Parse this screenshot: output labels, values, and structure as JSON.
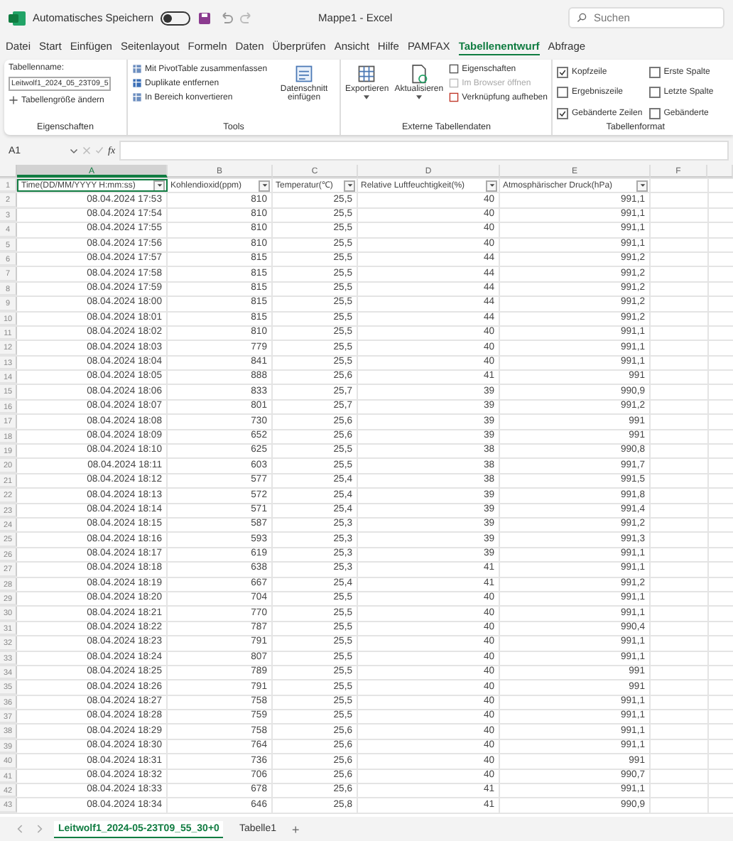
{
  "titlebar": {
    "autosave_label": "Automatisches Speichern",
    "autosave_on": false,
    "title": "Mappe1 - Excel",
    "search_placeholder": "Suchen"
  },
  "menu_tabs": [
    {
      "label": "Datei",
      "selected": false
    },
    {
      "label": "Start",
      "selected": false
    },
    {
      "label": "Einfügen",
      "selected": false
    },
    {
      "label": "Seitenlayout",
      "selected": false
    },
    {
      "label": "Formeln",
      "selected": false
    },
    {
      "label": "Daten",
      "selected": false
    },
    {
      "label": "Überprüfen",
      "selected": false
    },
    {
      "label": "Ansicht",
      "selected": false
    },
    {
      "label": "Hilfe",
      "selected": false
    },
    {
      "label": "PAMFAX",
      "selected": false
    },
    {
      "label": "Tabellenentwurf",
      "selected": true
    },
    {
      "label": "Abfrage",
      "selected": false
    }
  ],
  "ribbon": {
    "eigenschaften": {
      "name_label": "Tabellenname:",
      "name_value": "Leitwolf1_2024_05_23T09_5",
      "resize": "Tabellengröße ändern",
      "group": "Eigenschaften"
    },
    "tools": {
      "items": [
        "Mit PivotTable zusammenfassen",
        "Duplikate entfernen",
        "In Bereich konvertieren"
      ],
      "slicer": "Datenschnitt einfügen",
      "group": "Tools"
    },
    "extern": {
      "export": "Exportieren",
      "refresh": "Aktualisieren",
      "items": [
        {
          "label": "Eigenschaften",
          "disabled": false
        },
        {
          "label": "Im Browser öffnen",
          "disabled": true
        },
        {
          "label": "Verknüpfung aufheben",
          "disabled": false
        }
      ],
      "group": "Externe Tabellendaten"
    },
    "format": {
      "options": [
        {
          "label": "Kopfzeile",
          "checked": true
        },
        {
          "label": "Ergebniszeile",
          "checked": false
        },
        {
          "label": "Gebänderte Zeilen",
          "checked": true
        },
        {
          "label": "Erste Spalte",
          "checked": false
        },
        {
          "label": "Letzte Spalte",
          "checked": false
        },
        {
          "label": "Gebänderte",
          "checked": false
        }
      ],
      "group": "Tabellenformat"
    }
  },
  "formula_bar": {
    "name_box": "A1",
    "fx": "fx"
  },
  "sheet": {
    "columns": [
      {
        "letter": "A",
        "selected": true
      },
      {
        "letter": "B",
        "selected": false
      },
      {
        "letter": "C",
        "selected": false
      },
      {
        "letter": "D",
        "selected": false
      },
      {
        "letter": "E",
        "selected": false
      },
      {
        "letter": "F",
        "selected": false
      }
    ],
    "header_row": {
      "number": "1",
      "cells": [
        "Time(DD/MM/YYYY H:mm:ss)",
        "Kohlendioxid(ppm)",
        "Temperatur(℃)",
        "Relative Luftfeuchtigkeit(%)",
        "Atmosphärischer Druck(hPa)"
      ]
    },
    "rows": [
      {
        "number": "2",
        "cells": [
          "08.04.2024 17:53",
          "810",
          "25,5",
          "40",
          "991,1"
        ]
      },
      {
        "number": "3",
        "cells": [
          "08.04.2024 17:54",
          "810",
          "25,5",
          "40",
          "991,1"
        ]
      },
      {
        "number": "4",
        "cells": [
          "08.04.2024 17:55",
          "810",
          "25,5",
          "40",
          "991,1"
        ]
      },
      {
        "number": "5",
        "cells": [
          "08.04.2024 17:56",
          "810",
          "25,5",
          "40",
          "991,1"
        ]
      },
      {
        "number": "6",
        "cells": [
          "08.04.2024 17:57",
          "815",
          "25,5",
          "44",
          "991,2"
        ]
      },
      {
        "number": "7",
        "cells": [
          "08.04.2024 17:58",
          "815",
          "25,5",
          "44",
          "991,2"
        ]
      },
      {
        "number": "8",
        "cells": [
          "08.04.2024 17:59",
          "815",
          "25,5",
          "44",
          "991,2"
        ]
      },
      {
        "number": "9",
        "cells": [
          "08.04.2024 18:00",
          "815",
          "25,5",
          "44",
          "991,2"
        ]
      },
      {
        "number": "10",
        "cells": [
          "08.04.2024 18:01",
          "815",
          "25,5",
          "44",
          "991,2"
        ]
      },
      {
        "number": "11",
        "cells": [
          "08.04.2024 18:02",
          "810",
          "25,5",
          "40",
          "991,1"
        ]
      },
      {
        "number": "12",
        "cells": [
          "08.04.2024 18:03",
          "779",
          "25,5",
          "40",
          "991,1"
        ]
      },
      {
        "number": "13",
        "cells": [
          "08.04.2024 18:04",
          "841",
          "25,5",
          "40",
          "991,1"
        ]
      },
      {
        "number": "14",
        "cells": [
          "08.04.2024 18:05",
          "888",
          "25,6",
          "41",
          "991"
        ]
      },
      {
        "number": "15",
        "cells": [
          "08.04.2024 18:06",
          "833",
          "25,7",
          "39",
          "990,9"
        ]
      },
      {
        "number": "16",
        "cells": [
          "08.04.2024 18:07",
          "801",
          "25,7",
          "39",
          "991,2"
        ]
      },
      {
        "number": "17",
        "cells": [
          "08.04.2024 18:08",
          "730",
          "25,6",
          "39",
          "991"
        ]
      },
      {
        "number": "18",
        "cells": [
          "08.04.2024 18:09",
          "652",
          "25,6",
          "39",
          "991"
        ]
      },
      {
        "number": "19",
        "cells": [
          "08.04.2024 18:10",
          "625",
          "25,5",
          "38",
          "990,8"
        ]
      },
      {
        "number": "20",
        "cells": [
          "08.04.2024 18:11",
          "603",
          "25,5",
          "38",
          "991,7"
        ]
      },
      {
        "number": "21",
        "cells": [
          "08.04.2024 18:12",
          "577",
          "25,4",
          "38",
          "991,5"
        ]
      },
      {
        "number": "22",
        "cells": [
          "08.04.2024 18:13",
          "572",
          "25,4",
          "39",
          "991,8"
        ]
      },
      {
        "number": "23",
        "cells": [
          "08.04.2024 18:14",
          "571",
          "25,4",
          "39",
          "991,4"
        ]
      },
      {
        "number": "24",
        "cells": [
          "08.04.2024 18:15",
          "587",
          "25,3",
          "39",
          "991,2"
        ]
      },
      {
        "number": "25",
        "cells": [
          "08.04.2024 18:16",
          "593",
          "25,3",
          "39",
          "991,3"
        ]
      },
      {
        "number": "26",
        "cells": [
          "08.04.2024 18:17",
          "619",
          "25,3",
          "39",
          "991,1"
        ]
      },
      {
        "number": "27",
        "cells": [
          "08.04.2024 18:18",
          "638",
          "25,3",
          "41",
          "991,1"
        ]
      },
      {
        "number": "28",
        "cells": [
          "08.04.2024 18:19",
          "667",
          "25,4",
          "41",
          "991,2"
        ]
      },
      {
        "number": "29",
        "cells": [
          "08.04.2024 18:20",
          "704",
          "25,5",
          "40",
          "991,1"
        ]
      },
      {
        "number": "30",
        "cells": [
          "08.04.2024 18:21",
          "770",
          "25,5",
          "40",
          "991,1"
        ]
      },
      {
        "number": "31",
        "cells": [
          "08.04.2024 18:22",
          "787",
          "25,5",
          "40",
          "990,4"
        ]
      },
      {
        "number": "32",
        "cells": [
          "08.04.2024 18:23",
          "791",
          "25,5",
          "40",
          "991,1"
        ]
      },
      {
        "number": "33",
        "cells": [
          "08.04.2024 18:24",
          "807",
          "25,5",
          "40",
          "991,1"
        ]
      },
      {
        "number": "34",
        "cells": [
          "08.04.2024 18:25",
          "789",
          "25,5",
          "40",
          "991"
        ]
      },
      {
        "number": "35",
        "cells": [
          "08.04.2024 18:26",
          "791",
          "25,5",
          "40",
          "991"
        ]
      },
      {
        "number": "36",
        "cells": [
          "08.04.2024 18:27",
          "758",
          "25,5",
          "40",
          "991,1"
        ]
      },
      {
        "number": "37",
        "cells": [
          "08.04.2024 18:28",
          "759",
          "25,5",
          "40",
          "991,1"
        ]
      },
      {
        "number": "38",
        "cells": [
          "08.04.2024 18:29",
          "758",
          "25,6",
          "40",
          "991,1"
        ]
      },
      {
        "number": "39",
        "cells": [
          "08.04.2024 18:30",
          "764",
          "25,6",
          "40",
          "991,1"
        ]
      },
      {
        "number": "40",
        "cells": [
          "08.04.2024 18:31",
          "736",
          "25,6",
          "40",
          "991"
        ]
      },
      {
        "number": "41",
        "cells": [
          "08.04.2024 18:32",
          "706",
          "25,6",
          "40",
          "990,7"
        ]
      },
      {
        "number": "42",
        "cells": [
          "08.04.2024 18:33",
          "678",
          "25,6",
          "41",
          "991,1"
        ]
      },
      {
        "number": "43",
        "cells": [
          "08.04.2024 18:34",
          "646",
          "25,8",
          "41",
          "990,9"
        ]
      }
    ]
  },
  "sheet_tabs": [
    {
      "label": "Leitwolf1_2024-05-23T09_55_30+0",
      "selected": true
    },
    {
      "label": "Tabelle1",
      "selected": false
    }
  ],
  "add_sheet": "+"
}
